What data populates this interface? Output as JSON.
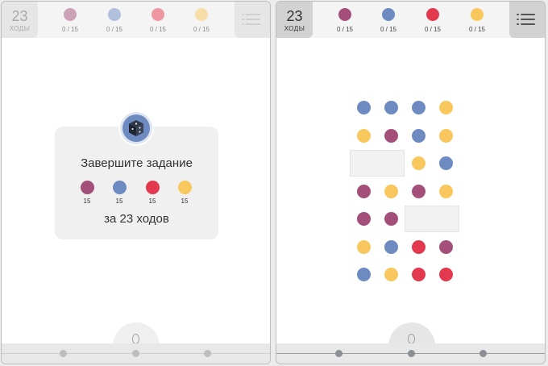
{
  "colors": {
    "purple": "#a34f7a",
    "blue": "#6d8bc1",
    "red": "#e3394e",
    "yellow": "#f8c75e"
  },
  "left_panel": {
    "moves": {
      "number": "23",
      "label": "ХОДЫ"
    },
    "goals": [
      {
        "color": "purple",
        "count": "0 / 15"
      },
      {
        "color": "blue",
        "count": "0 / 15"
      },
      {
        "color": "red",
        "count": "0 / 15"
      },
      {
        "color": "yellow",
        "count": "0 / 15"
      }
    ],
    "menu_icon": "menu-list-icon",
    "objective_card": {
      "icon": "dice-icon",
      "title": "Завершите задание",
      "requirements": [
        {
          "color": "purple",
          "count": "15"
        },
        {
          "color": "blue",
          "count": "15"
        },
        {
          "color": "red",
          "count": "15"
        },
        {
          "color": "yellow",
          "count": "15"
        }
      ],
      "footer": "за 23 ходов"
    },
    "bottom_nav": [
      "dot",
      "dot",
      "dot"
    ]
  },
  "right_panel": {
    "moves": {
      "number": "23",
      "label": "ХОДЫ"
    },
    "goals": [
      {
        "color": "purple",
        "count": "0 / 15"
      },
      {
        "color": "blue",
        "count": "0 / 15"
      },
      {
        "color": "red",
        "count": "0 / 15"
      },
      {
        "color": "yellow",
        "count": "0 / 15"
      }
    ],
    "menu_icon": "menu-list-icon",
    "board": [
      [
        "blue",
        "blue",
        "blue",
        "yellow"
      ],
      [
        "yellow",
        "purple",
        "blue",
        "yellow"
      ],
      [
        null,
        null,
        "yellow",
        "blue"
      ],
      [
        "purple",
        "yellow",
        "purple",
        "yellow"
      ],
      [
        "purple",
        "purple",
        null,
        null
      ],
      [
        "yellow",
        "blue",
        "red",
        "purple"
      ],
      [
        "blue",
        "yellow",
        "red",
        "red"
      ]
    ],
    "bottom_nav": [
      "dot",
      "dot",
      "dot"
    ]
  }
}
